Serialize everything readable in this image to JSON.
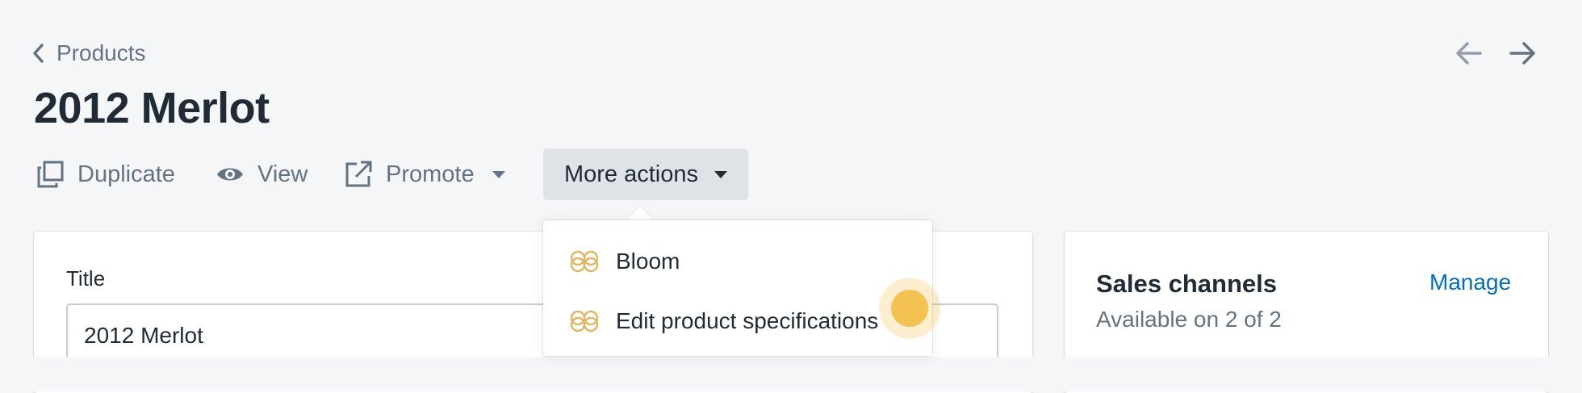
{
  "breadcrumb": {
    "label": "Products"
  },
  "pager": {
    "prev_icon": "arrow-left-icon",
    "next_icon": "arrow-right-icon"
  },
  "page": {
    "title": "2012 Merlot"
  },
  "actions": {
    "duplicate": {
      "label": "Duplicate",
      "icon": "duplicate-icon"
    },
    "view": {
      "label": "View",
      "icon": "eye-icon"
    },
    "promote": {
      "label": "Promote",
      "icon": "external-link-icon"
    },
    "more": {
      "label": "More actions"
    }
  },
  "dropdown": {
    "items": [
      {
        "label": "Bloom",
        "icon": "bloom-app-icon"
      },
      {
        "label": "Edit product specifications",
        "icon": "bloom-app-icon"
      }
    ]
  },
  "product_form": {
    "title_label": "Title",
    "title_value": "2012 Merlot"
  },
  "sales_channels": {
    "heading": "Sales channels",
    "manage_label": "Manage",
    "availability": "Available on 2 of 2"
  },
  "colors": {
    "background": "#f4f6f8",
    "text": "#212b36",
    "subdued": "#637381",
    "link": "#006fbb",
    "bloom_icon": "#e0b760",
    "cursor": "#f4c250"
  }
}
